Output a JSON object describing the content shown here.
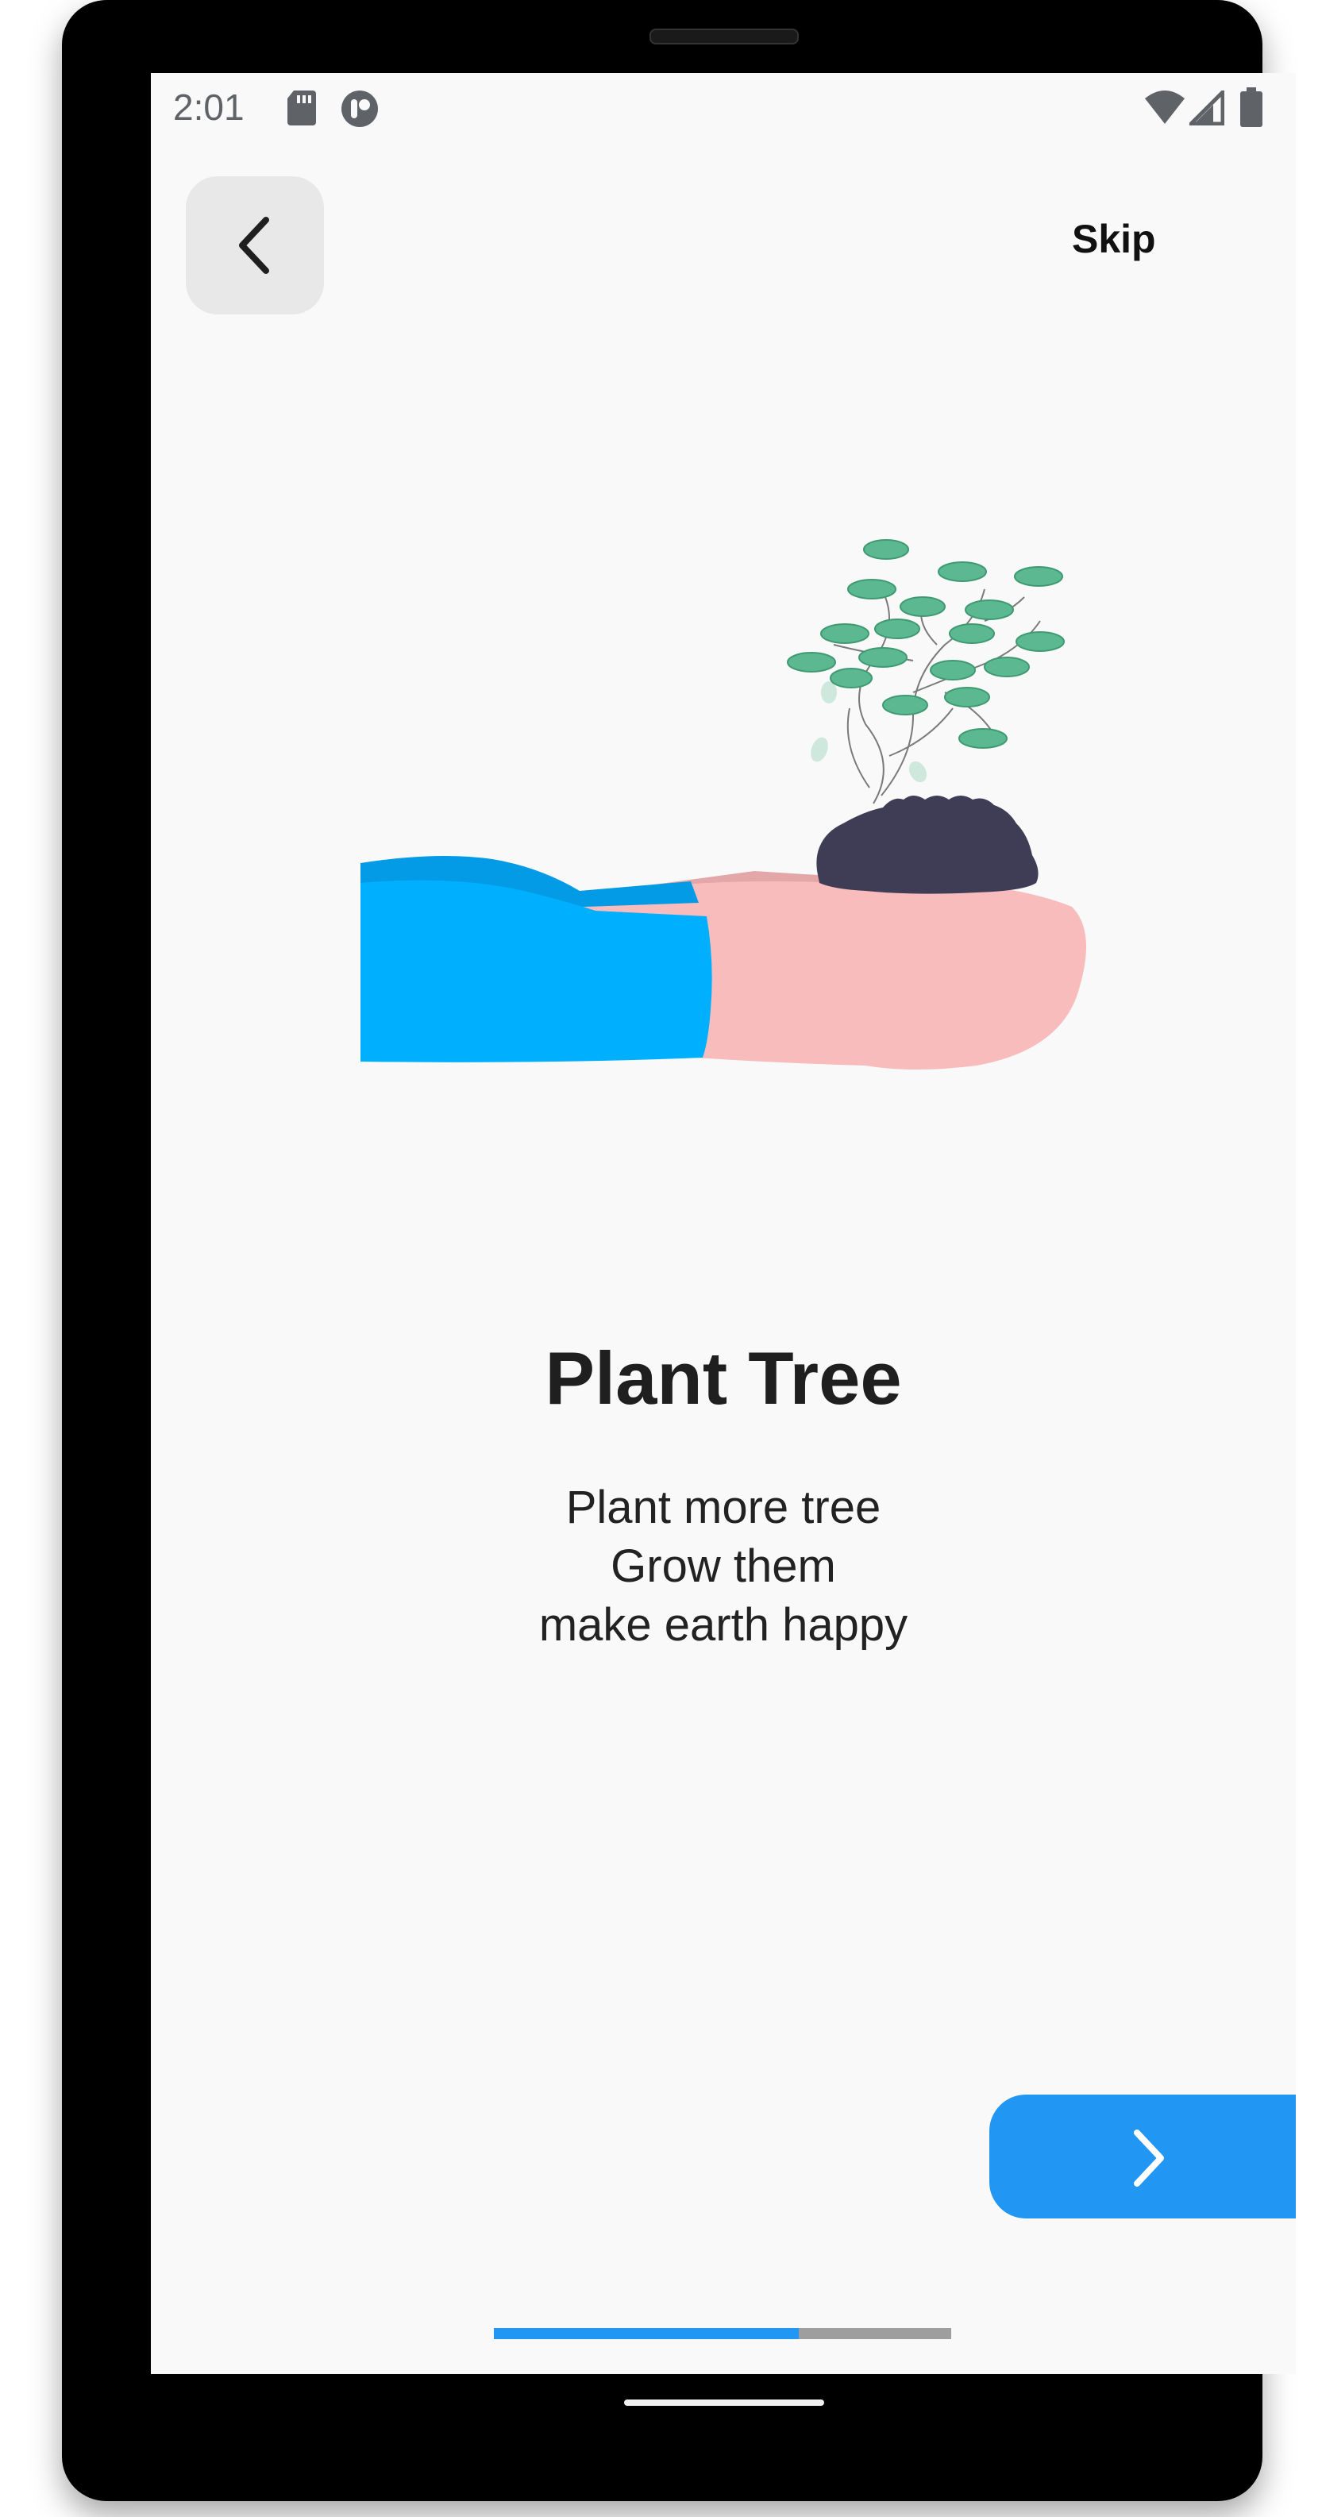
{
  "status_bar": {
    "time": "2:01",
    "left_icons": [
      "sd-card-icon",
      "assistant-icon"
    ],
    "right_icons": [
      "wifi-icon",
      "signal-icon",
      "battery-icon"
    ]
  },
  "header": {
    "back_icon": "chevron-left-icon",
    "skip_label": "Skip"
  },
  "onboarding": {
    "illustration": "hand-holding-plant-illustration",
    "title": "Plant Tree",
    "description": [
      "Plant more tree",
      "Grow them",
      "make earth happy"
    ]
  },
  "next_button": {
    "icon": "chevron-right-icon"
  },
  "progress": {
    "value": 0.667
  },
  "colors": {
    "accent": "#2196f3",
    "sleeve": "#00b0ff",
    "sleeve_dark": "#039be5",
    "skin": "#f8bcbc",
    "soil": "#3f3d56",
    "leaf": "#5bb891",
    "background": "#f9f9f9"
  }
}
